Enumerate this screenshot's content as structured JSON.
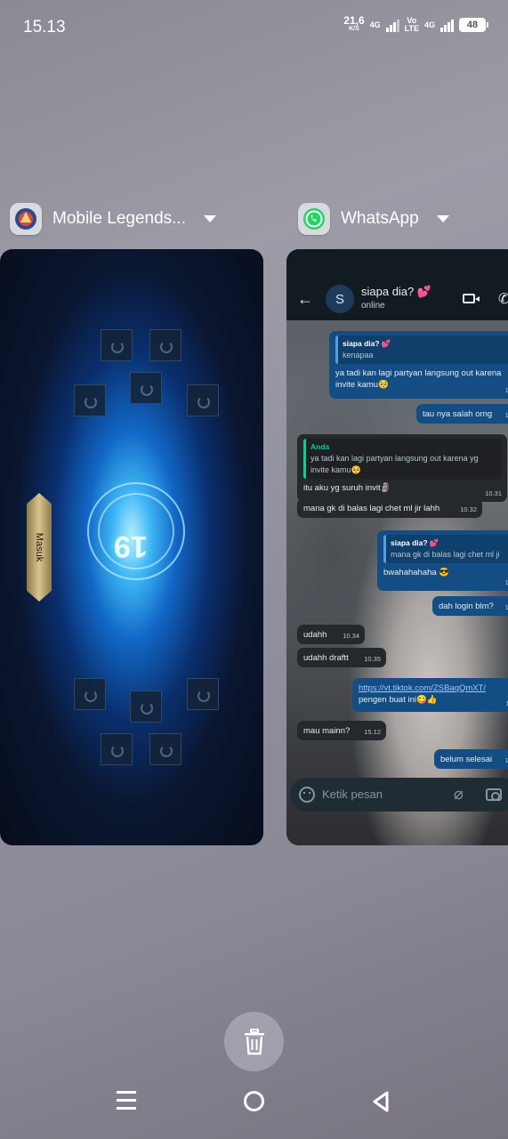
{
  "status_bar": {
    "time": "15.13",
    "net_speed_value": "21,6",
    "net_speed_unit": "K/S",
    "network_1": "4G",
    "volte_top": "Vo",
    "volte_bottom": "LTE",
    "network_2": "4G",
    "battery": "48"
  },
  "apps": [
    {
      "title": "Mobile Legends...",
      "icon": "mobile-legends-icon",
      "masuk_label": "Masuk",
      "center_text": "19"
    },
    {
      "title": "WhatsApp",
      "icon": "whatsapp-icon"
    }
  ],
  "whatsapp": {
    "contact_initial": "S",
    "contact_name": "siapa dia? 💕",
    "contact_status": "online",
    "messages": [
      {
        "dir": "out",
        "quote_name": "siapa dia? 💕",
        "quote_text": "kenapaa",
        "text": "ya tadi kan lagi partyan langsung out karena invite kamu🥺",
        "time": "10"
      },
      {
        "dir": "out",
        "text": "tau nya salah orng",
        "time": "10"
      },
      {
        "dir": "in",
        "quote_name": "Anda",
        "quote_text": "ya tadi kan lagi partyan langsung out karena yg invite kamu🥺",
        "text": "itu aku yg suruh invit🗿",
        "time": "10.31"
      },
      {
        "dir": "in",
        "text": "mana gk di balas lagi chet ml jir lahh",
        "time": "10.32"
      },
      {
        "dir": "out",
        "quote_name": "siapa dia? 💕",
        "quote_text": "mana gk di balas lagi chet ml ji",
        "text": "bwahahahaha 😎",
        "time": "10"
      },
      {
        "dir": "out",
        "text": "dah login blm?",
        "time": "10"
      },
      {
        "dir": "in",
        "text": "udahh",
        "time": "10.34"
      },
      {
        "dir": "in",
        "text": "udahh draftt",
        "time": "10.35"
      },
      {
        "dir": "out",
        "link": "https://vt.tiktok.com/ZSBaqQmXT/",
        "text": "pengen buat ini😋👍",
        "time": "11"
      },
      {
        "dir": "in",
        "text": "mau mainn?",
        "time": "15.12"
      },
      {
        "dir": "out",
        "text": "belum selesai",
        "time": "15"
      }
    ],
    "input_placeholder": "Ketik pesan"
  },
  "controls": {
    "trash_icon": "trash-icon",
    "nav": [
      "menu-icon",
      "home-icon",
      "back-icon"
    ]
  }
}
